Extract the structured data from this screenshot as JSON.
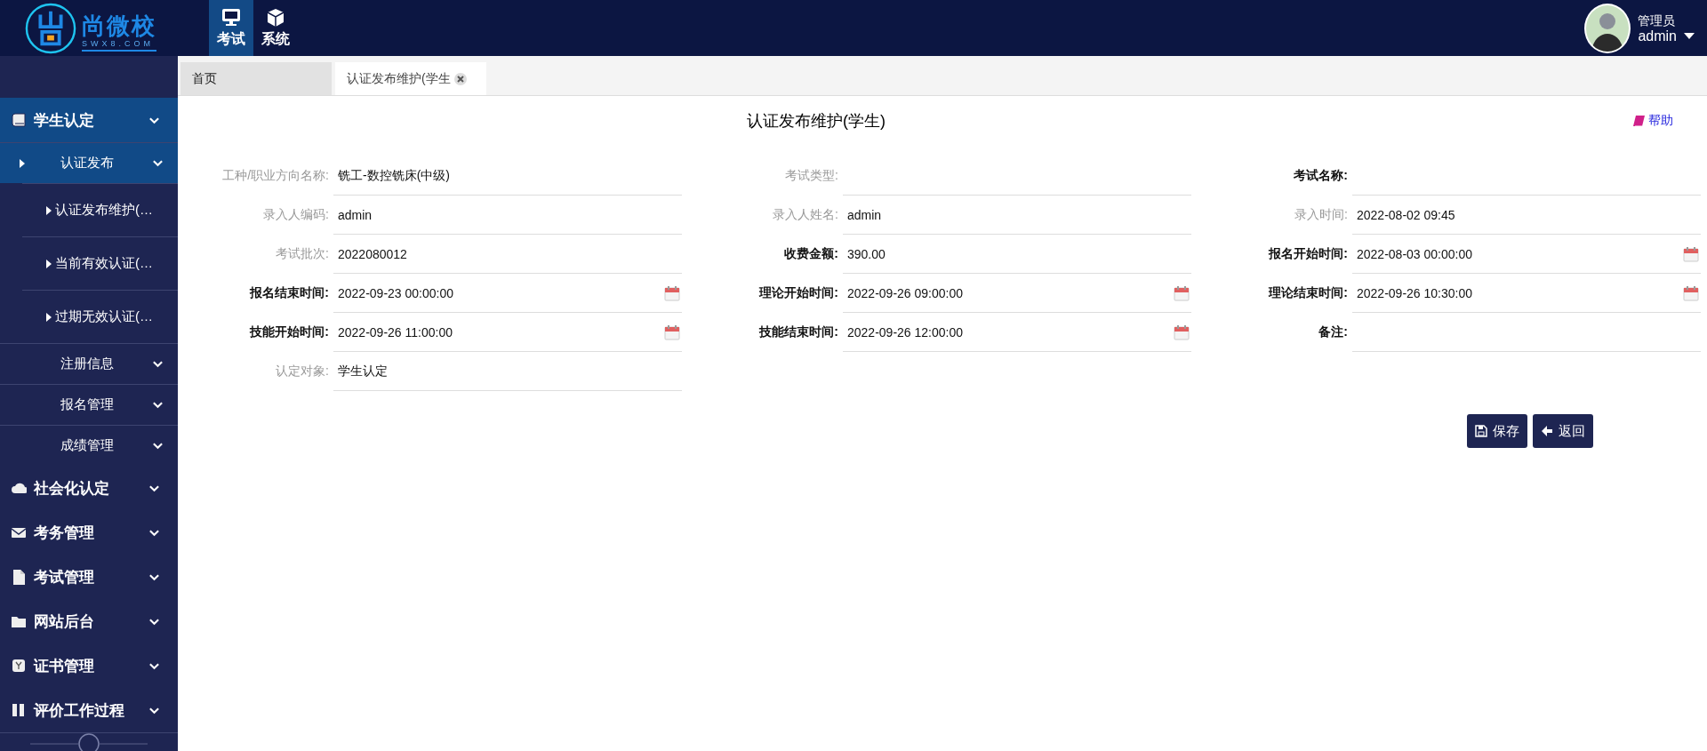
{
  "header": {
    "logo": {
      "name": "尚微校",
      "domain": "SWX8.COM"
    },
    "modules": [
      {
        "label": "考试",
        "selected": true
      },
      {
        "label": "系统",
        "selected": false
      }
    ],
    "user": {
      "role": "管理员",
      "name": "admin"
    }
  },
  "tabs": [
    {
      "label": "首页",
      "selected": false,
      "closable": false
    },
    {
      "label": "认证发布维护(学生",
      "selected": true,
      "closable": true
    }
  ],
  "sidebar": {
    "items": [
      {
        "label": "学生认定",
        "selected": true,
        "children": [
          {
            "label": "认证发布",
            "selected": true,
            "children": [
              {
                "label": "认证发布维护(…",
                "selected": false
              },
              {
                "label": "当前有效认证(…",
                "selected": false
              },
              {
                "label": "过期无效认证(…",
                "selected": false
              }
            ]
          },
          {
            "label": "注册信息",
            "selected": false
          },
          {
            "label": "报名管理",
            "selected": false
          },
          {
            "label": "成绩管理",
            "selected": false
          }
        ]
      },
      {
        "label": "社会化认定",
        "selected": false
      },
      {
        "label": "考务管理",
        "selected": false
      },
      {
        "label": "考试管理",
        "selected": false
      },
      {
        "label": "网站后台",
        "selected": false
      },
      {
        "label": "证书管理",
        "selected": false
      },
      {
        "label": "评价工作过程",
        "selected": false
      }
    ]
  },
  "page": {
    "title": "认证发布维护(学生)",
    "help": "帮助",
    "fields": [
      {
        "label": "工种/职业方向名称:",
        "value": "铣工-数控铣床(中级)",
        "required": false,
        "date_picker": false
      },
      {
        "label": "考试类型:",
        "required": false,
        "date_picker": false
      },
      {
        "label": "考试名称:",
        "required": true,
        "date_picker": false
      },
      {
        "label": "录入人编码:",
        "value": "admin",
        "required": false,
        "date_picker": false
      },
      {
        "label": "录入人姓名:",
        "value": "admin",
        "required": false,
        "date_picker": false
      },
      {
        "label": "录入时间:",
        "value": "2022-08-02 09:45",
        "required": false,
        "date_picker": false
      },
      {
        "label": "考试批次:",
        "value": "2022080012",
        "required": false,
        "date_picker": false
      },
      {
        "label": "收费金额:",
        "value": "390.00",
        "required": true,
        "date_picker": false
      },
      {
        "label": "报名开始时间:",
        "value": "2022-08-03 00:00:00",
        "required": true,
        "date_picker": true
      },
      {
        "label": "报名结束时间:",
        "value": "2022-09-23 00:00:00",
        "required": true,
        "date_picker": true
      },
      {
        "label": "理论开始时间:",
        "value": "2022-09-26 09:00:00",
        "required": true,
        "date_picker": true
      },
      {
        "label": "理论结束时间:",
        "value": "2022-09-26 10:30:00",
        "required": true,
        "date_picker": true
      },
      {
        "label": "技能开始时间:",
        "value": "2022-09-26 11:00:00",
        "required": true,
        "date_picker": true
      },
      {
        "label": "技能结束时间:",
        "value": "2022-09-26 12:00:00",
        "required": true,
        "date_picker": true
      },
      {
        "label": "备注:",
        "required": true,
        "date_picker": false
      },
      {
        "label": "认定对象:",
        "value": "学生认定",
        "required": false,
        "date_picker": false
      }
    ],
    "buttons": [
      {
        "label": "保存",
        "kind": "save"
      },
      {
        "label": "返回",
        "kind": "back"
      }
    ]
  }
}
